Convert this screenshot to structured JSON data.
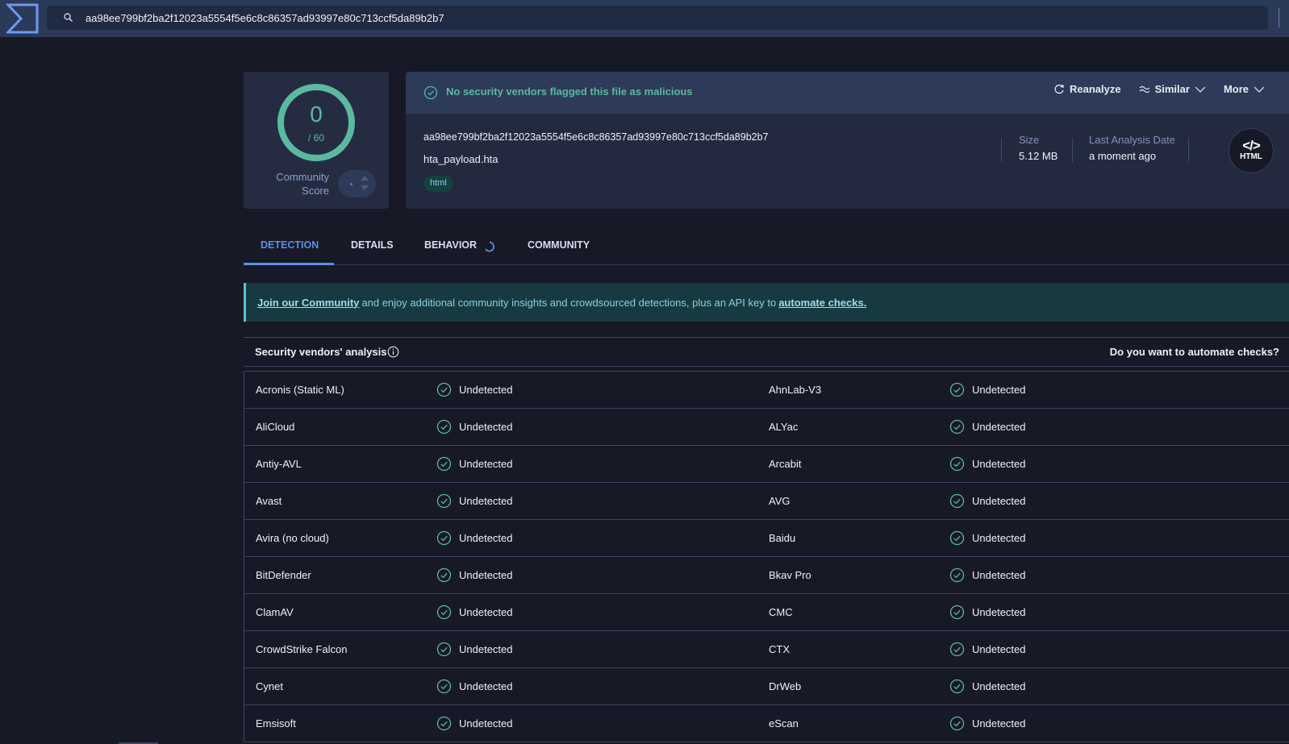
{
  "topbar": {
    "logo_icon": "sigma-logo-icon",
    "search_icon": "search-icon",
    "search_value": "aa98ee799bf2ba2f12023a5554f5e6c8c86357ad93997e80c713ccf5da89b2b7"
  },
  "score": {
    "detections": "0",
    "total": "/ 60",
    "community_label_line1": "Community",
    "community_label_line2": "Score",
    "ring_color": "#5bb9a0"
  },
  "file": {
    "status_message": "No security vendors flagged this file as malicious",
    "hash": "aa98ee799bf2ba2f12023a5554f5e6c8c86357ad93997e80c713ccf5da89b2b7",
    "name": "hta_payload.hta",
    "tag": "html",
    "size_label": "Size",
    "size_value": "5.12 MB",
    "date_label": "Last Analysis Date",
    "date_value": "a moment ago",
    "type_glyph": "</>",
    "type_label": "HTML"
  },
  "actions": {
    "reanalyze": "Reanalyze",
    "similar": "Similar",
    "more": "More"
  },
  "tabs": [
    {
      "label": "DETECTION",
      "active": true
    },
    {
      "label": "DETAILS",
      "active": false
    },
    {
      "label": "BEHAVIOR",
      "active": false
    },
    {
      "label": "COMMUNITY",
      "active": false
    }
  ],
  "banner": {
    "link1": "Join our Community",
    "text": "and enjoy additional community insights and crowdsourced detections, plus an API key to",
    "link2": "automate checks."
  },
  "vendors": {
    "title": "Security vendors' analysis",
    "automate_prompt": "Do you want to automate checks?",
    "rows": [
      {
        "left": {
          "name": "Acronis (Static ML)",
          "result": "Undetected"
        },
        "right": {
          "name": "AhnLab-V3",
          "result": "Undetected"
        }
      },
      {
        "left": {
          "name": "AliCloud",
          "result": "Undetected"
        },
        "right": {
          "name": "ALYac",
          "result": "Undetected"
        }
      },
      {
        "left": {
          "name": "Antiy-AVL",
          "result": "Undetected"
        },
        "right": {
          "name": "Arcabit",
          "result": "Undetected"
        }
      },
      {
        "left": {
          "name": "Avast",
          "result": "Undetected"
        },
        "right": {
          "name": "AVG",
          "result": "Undetected"
        }
      },
      {
        "left": {
          "name": "Avira (no cloud)",
          "result": "Undetected"
        },
        "right": {
          "name": "Baidu",
          "result": "Undetected"
        }
      },
      {
        "left": {
          "name": "BitDefender",
          "result": "Undetected"
        },
        "right": {
          "name": "Bkav Pro",
          "result": "Undetected"
        }
      },
      {
        "left": {
          "name": "ClamAV",
          "result": "Undetected"
        },
        "right": {
          "name": "CMC",
          "result": "Undetected"
        }
      },
      {
        "left": {
          "name": "CrowdStrike Falcon",
          "result": "Undetected"
        },
        "right": {
          "name": "CTX",
          "result": "Undetected"
        }
      },
      {
        "left": {
          "name": "Cynet",
          "result": "Undetected"
        },
        "right": {
          "name": "DrWeb",
          "result": "Undetected"
        }
      },
      {
        "left": {
          "name": "Emsisoft",
          "result": "Undetected"
        },
        "right": {
          "name": "eScan",
          "result": "Undetected"
        }
      }
    ]
  },
  "colors": {
    "accent_blue": "#5a8fe8",
    "clean_green": "#5bb9a0",
    "banner_bg": "#173a40"
  }
}
